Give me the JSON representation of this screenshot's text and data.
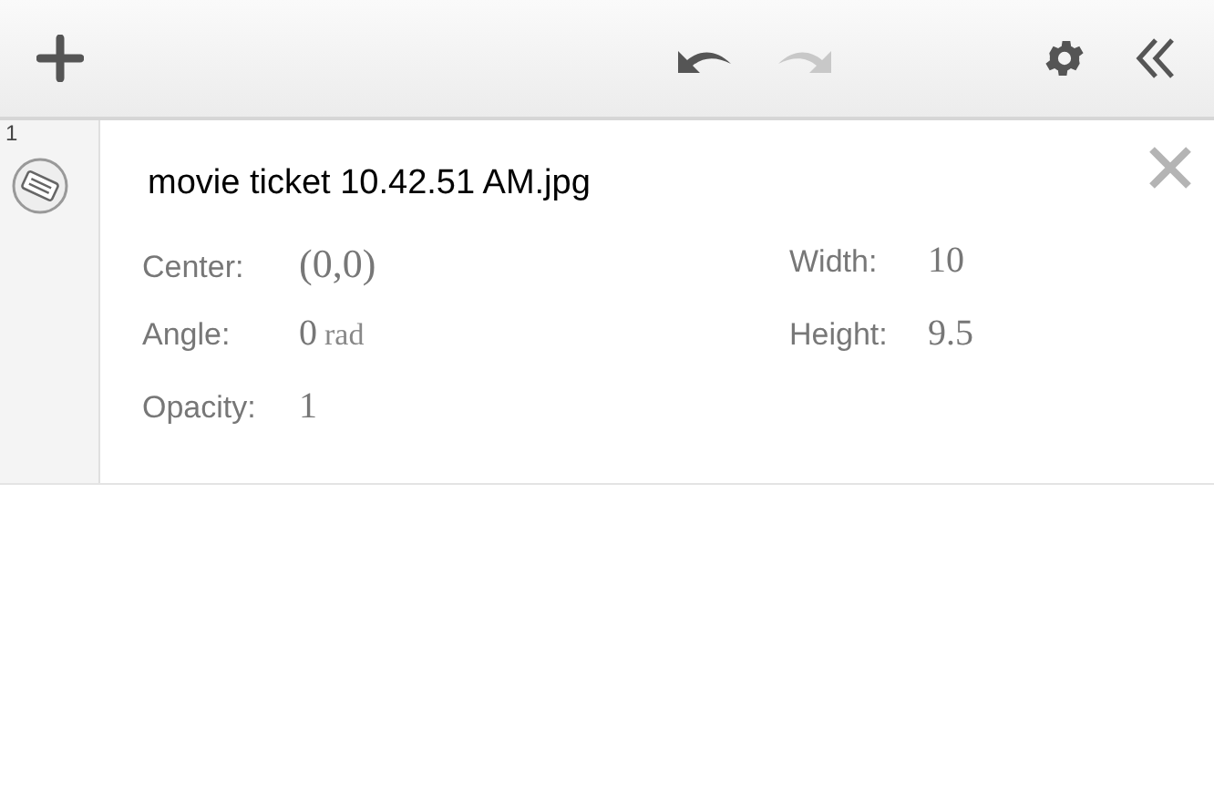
{
  "toolbar": {
    "undo": {
      "disabled": false
    },
    "redo": {
      "disabled": true
    }
  },
  "items": [
    {
      "index": "1",
      "name": "movie ticket 10.42.51 AM.jpg",
      "left_properties": [
        {
          "label": "Center:",
          "value": "(0,0)"
        },
        {
          "label": "Angle:",
          "value": "0",
          "unit": "rad"
        },
        {
          "label": "Opacity:",
          "value": "1"
        }
      ],
      "right_properties": [
        {
          "label": "Width:",
          "value": "10"
        },
        {
          "label": "Height:",
          "value": "9.5"
        }
      ]
    }
  ]
}
